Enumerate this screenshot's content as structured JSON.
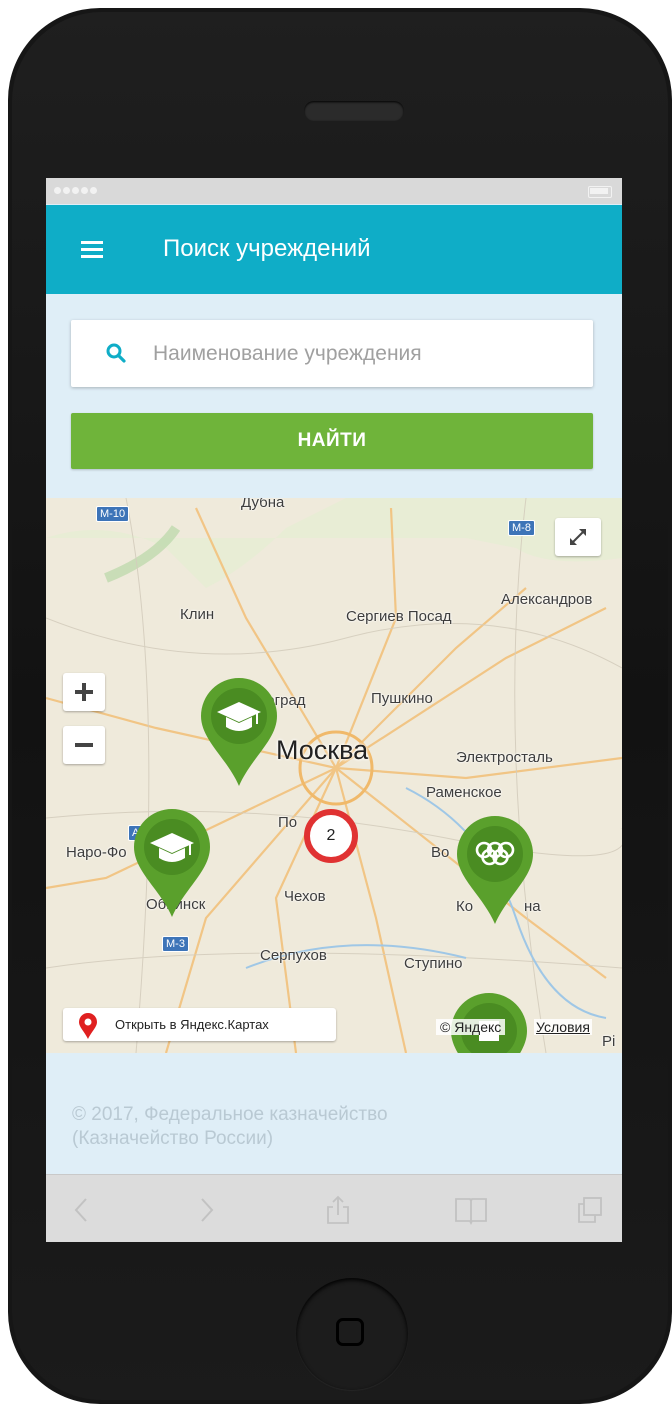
{
  "app": {
    "title": "Поиск учреждений"
  },
  "search": {
    "placeholder": "Наименование учреждения",
    "button_label": "НАЙТИ"
  },
  "map": {
    "cities": {
      "dubna": "Дубна",
      "aleksandrov": "Александров",
      "klin": "Клин",
      "sergiev_posad": "Сергиев Посад",
      "zelenograd": "Зеленоград",
      "pushkino": "Пушкино",
      "moscow": "Москва",
      "elektrostal": "Электросталь",
      "ramenskoe": "Раменское",
      "podolsk": "По",
      "naro_fominsk": "Наро-Фо",
      "obninsk": "Обнинск",
      "chekhov": "Чехов",
      "voskresensk": "Во",
      "kolomna": "Ко",
      "kolomna_end": "на",
      "serpukhov": "Серпухов",
      "stupino": "Ступино",
      "edge_label": "Рі"
    },
    "road_labels": {
      "m10": "M-10",
      "m8": "M-8",
      "a": "A-",
      "m3": "M-3"
    },
    "cluster_count": "2",
    "open_in_maps": "Открыть в Яндекс.Картах",
    "copyright": "© Яндекс",
    "terms": "Условия",
    "markers": [
      {
        "type": "graduation-cap-icon"
      },
      {
        "type": "graduation-cap-icon"
      },
      {
        "type": "olympic-rings-icon"
      },
      {
        "type": "building-icon"
      }
    ],
    "colors": {
      "pin_green": "#5aa02c",
      "cluster_red": "#e03232"
    }
  },
  "footer": {
    "copyright_line1": "© 2017, Федеральное казначейство",
    "copyright_line2": "(Казначейство России)"
  },
  "colors": {
    "app_bar": "#0fadc7",
    "button_green": "#6fb43a",
    "page_bg": "#dfeef7"
  },
  "browser_toolbar": {
    "icons": [
      "back-icon",
      "forward-icon",
      "share-icon",
      "bookmarks-icon",
      "tabs-icon"
    ]
  }
}
